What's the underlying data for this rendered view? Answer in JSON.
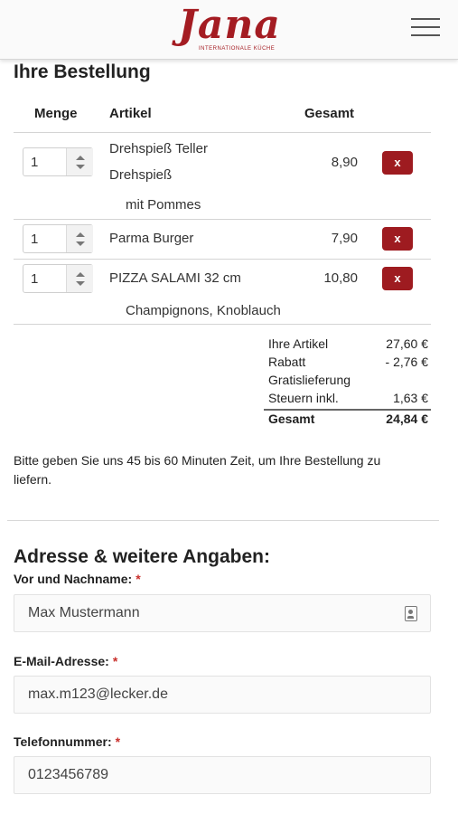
{
  "brand": {
    "name": "Jana",
    "tagline": "INTERNATIONALE KÜCHE",
    "color": "#a41c22"
  },
  "order": {
    "title": "Ihre Bestellung",
    "headers": {
      "qty": "Menge",
      "item": "Artikel",
      "total": "Gesamt"
    },
    "items": [
      {
        "qty": "1",
        "name": "Drehspieß Teller",
        "name2": "Drehspieß",
        "extra": "mit Pommes",
        "price": "8,90",
        "delete": "x"
      },
      {
        "qty": "1",
        "name": "Parma Burger",
        "price": "7,90",
        "delete": "x"
      },
      {
        "qty": "1",
        "name": "PIZZA SALAMI 32 cm",
        "extra": "Champignons, Knoblauch",
        "price": "10,80",
        "delete": "x"
      }
    ],
    "summary": [
      {
        "label": "Ihre Artikel",
        "value": "27,60 €"
      },
      {
        "label": "Rabatt",
        "value": "- 2,76 €"
      },
      {
        "label": "Gratislieferung",
        "value": ""
      },
      {
        "label": "Steuern inkl.",
        "value": "1,63 €"
      }
    ],
    "total": {
      "label": "Gesamt",
      "value": "24,84 €"
    },
    "delivery_note": "Bitte geben Sie uns 45 bis 60 Minuten Zeit, um Ihre Bestellung zu liefern."
  },
  "address": {
    "title": "Adresse & weitere Angaben:",
    "required_mark": "*",
    "name_label": "Vor und Nachname:",
    "name_value": "Max Mustermann",
    "email_label": "E-Mail-Adresse:",
    "email_value": "max.m123@lecker.de",
    "phone_label": "Telefonnummer:",
    "phone_value": "0123456789"
  },
  "icons": {
    "menu": "hamburger-menu-icon",
    "contact_card": "contact-card-icon",
    "spinner": "spinner-arrows-icon"
  },
  "colors": {
    "accent": "#9e1b20",
    "required": "#c9302c"
  }
}
